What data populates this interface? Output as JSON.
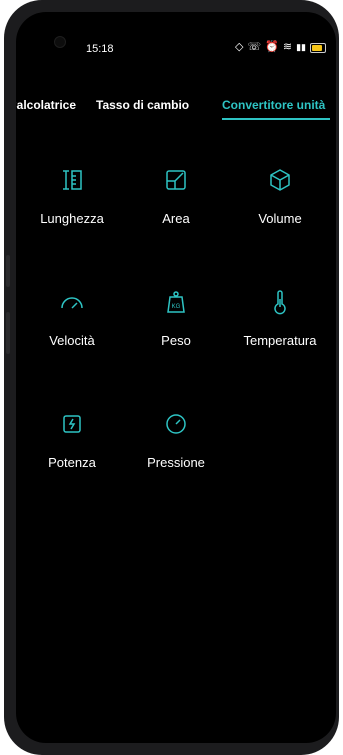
{
  "status_bar": {
    "time": "15:18",
    "icons": [
      "location-icon",
      "call-icon",
      "alarm-icon",
      "wifi-icon",
      "signal-icon",
      "battery-icon"
    ],
    "battery_level": 0.7
  },
  "tabs": [
    {
      "label": "Calcolatrice",
      "active": false
    },
    {
      "label": "Tasso di cambio",
      "active": false
    },
    {
      "label": "Convertitore unità",
      "active": true
    }
  ],
  "categories": [
    {
      "label": "Lunghezza",
      "icon": "ruler-icon"
    },
    {
      "label": "Area",
      "icon": "area-icon"
    },
    {
      "label": "Volume",
      "icon": "cube-icon"
    },
    {
      "label": "Velocità",
      "icon": "speedometer-icon"
    },
    {
      "label": "Peso",
      "icon": "weight-icon"
    },
    {
      "label": "Temperatura",
      "icon": "thermometer-icon"
    },
    {
      "label": "Potenza",
      "icon": "power-icon"
    },
    {
      "label": "Pressione",
      "icon": "pressure-gauge-icon"
    }
  ],
  "colors": {
    "accent": "#2ec4c4",
    "background": "#000000",
    "text": "#ffffff"
  }
}
